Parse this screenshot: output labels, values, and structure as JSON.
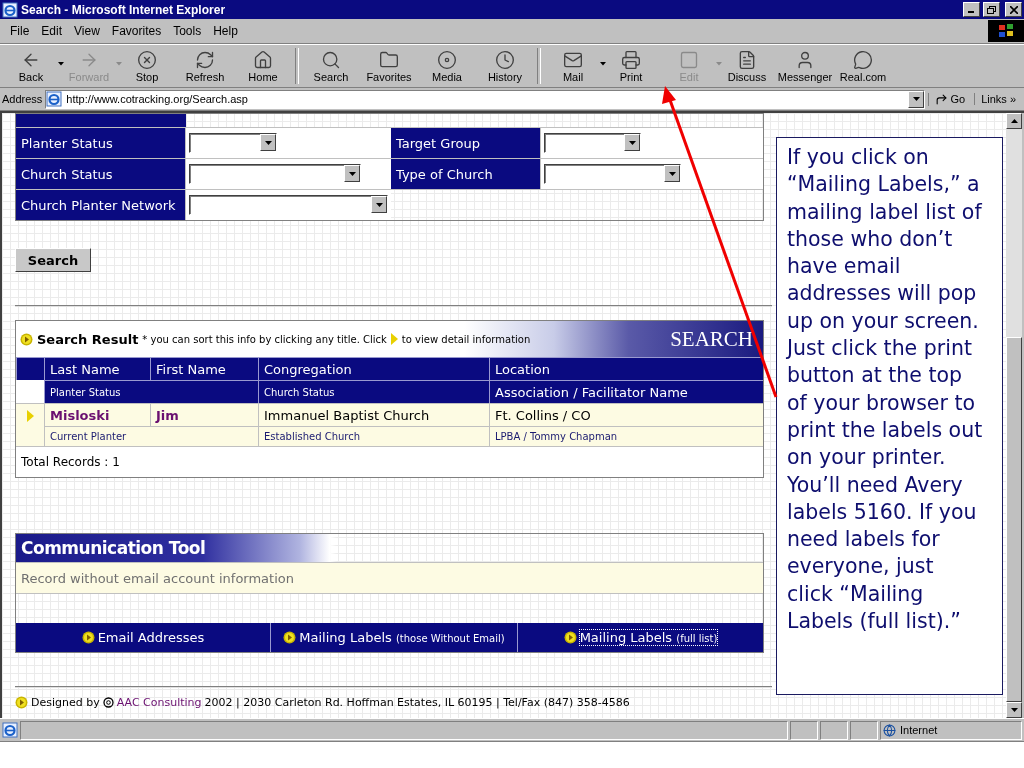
{
  "window": {
    "title": "Search - Microsoft Internet Explorer"
  },
  "menu": [
    {
      "label": "File"
    },
    {
      "label": "Edit"
    },
    {
      "label": "View"
    },
    {
      "label": "Favorites"
    },
    {
      "label": "Tools"
    },
    {
      "label": "Help"
    }
  ],
  "toolbar": [
    {
      "kind": "button",
      "label": "Back",
      "disabled": false,
      "dropdown": true
    },
    {
      "kind": "button",
      "label": "Forward",
      "disabled": true,
      "dropdown": true
    },
    {
      "kind": "button",
      "label": "Stop",
      "disabled": false,
      "dropdown": false
    },
    {
      "kind": "button",
      "label": "Refresh",
      "disabled": false,
      "dropdown": false
    },
    {
      "kind": "button",
      "label": "Home",
      "disabled": false,
      "dropdown": false
    },
    {
      "kind": "separator"
    },
    {
      "kind": "button",
      "label": "Search",
      "disabled": false,
      "dropdown": false
    },
    {
      "kind": "button",
      "label": "Favorites",
      "disabled": false,
      "dropdown": false
    },
    {
      "kind": "button",
      "label": "Media",
      "disabled": false,
      "dropdown": false
    },
    {
      "kind": "button",
      "label": "History",
      "disabled": false,
      "dropdown": false
    },
    {
      "kind": "separator"
    },
    {
      "kind": "button",
      "label": "Mail",
      "disabled": false,
      "dropdown": true
    },
    {
      "kind": "button",
      "label": "Print",
      "disabled": false,
      "dropdown": false
    },
    {
      "kind": "button",
      "label": "Edit",
      "disabled": true,
      "dropdown": true
    },
    {
      "kind": "button",
      "label": "Discuss",
      "disabled": false,
      "dropdown": false
    },
    {
      "kind": "button",
      "label": "Messenger",
      "disabled": false,
      "dropdown": false
    },
    {
      "kind": "button",
      "label": "Real.com",
      "disabled": false,
      "dropdown": false
    }
  ],
  "address_bar": {
    "label": "Address",
    "url": "http://www.cotracking.org/Search.asp",
    "go": "Go",
    "links": "Links",
    "links_chevron": "»"
  },
  "search_form": {
    "rows": [
      {
        "fields": [
          {
            "label": "Planter Status"
          },
          {
            "label": "Target Group"
          }
        ]
      },
      {
        "fields": [
          {
            "label": "Church Status"
          },
          {
            "label": "Type of Church"
          }
        ]
      },
      {
        "fields": [
          {
            "label": "Church Planter Network"
          }
        ]
      }
    ],
    "search_button": "Search"
  },
  "search_result": {
    "title": "Search Result",
    "note_before": "* you can sort this info by clicking any title. Click",
    "note_after": "to view detail information",
    "banner": "SEARCH",
    "header_1": [
      "Last Name",
      "First Name",
      "Congregation",
      "Location"
    ],
    "header_2": [
      "Planter Status",
      "Church Status",
      "Association / Facilitator Name"
    ],
    "rows": [
      {
        "last_name": "Misloski",
        "first_name": "Jim",
        "congregation": "Immanuel Baptist Church",
        "location": "Ft. Collins / CO",
        "planter_status": "Current Planter",
        "church_status": "Established Church",
        "association": "LPBA / Tommy Chapman"
      }
    ],
    "total": "Total Records : 1"
  },
  "communication_tool": {
    "title": "Communication Tool",
    "message": "Record without email account information",
    "links": [
      {
        "label": "Email Addresses",
        "focused": false
      },
      {
        "label": "Mailing Labels",
        "note": "(those Without Email)",
        "focused": false
      },
      {
        "label": "Mailing Labels",
        "note": "(full list)",
        "focused": true
      }
    ]
  },
  "footer": {
    "before": "Designed by",
    "link": "AAC Consulting",
    "after": "2002 | 2030 Carleton Rd. Hoffman Estates, IL 60195 | Tel/Fax (847) 358-4586"
  },
  "callout": {
    "text": "If you click on “Mailing Labels,” a mailing label list of those who don’t have email addresses will pop up on your screen.  Just click the print button at the top of your browser to print the labels out on your printer.  You’ll need Avery labels 5160.  If you need labels for everyone, just click “Mailing Labels (full list).”"
  },
  "status_bar": {
    "zone": "Internet"
  }
}
